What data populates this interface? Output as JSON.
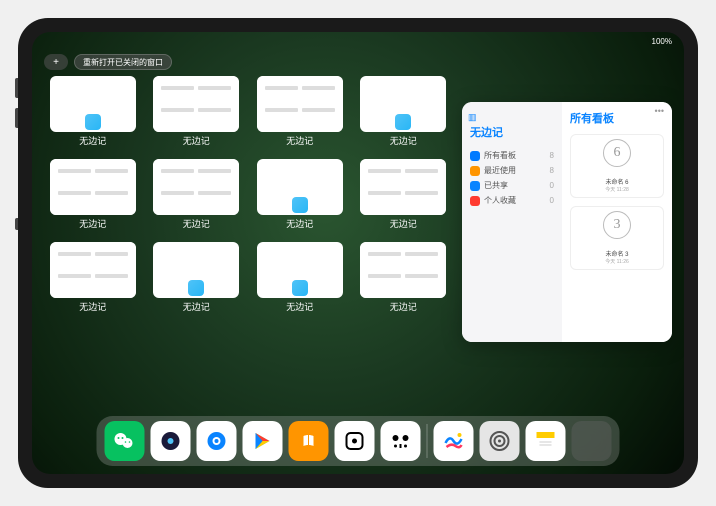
{
  "status": {
    "time": "",
    "battery": "100%"
  },
  "topbar": {
    "plus": "+",
    "reopen": "重新打开已关闭的窗口"
  },
  "switcher": {
    "app_name": "无边记",
    "cards": [
      {
        "type": "blank"
      },
      {
        "type": "split"
      },
      {
        "type": "split"
      },
      {
        "type": "blank"
      },
      {
        "type": "split"
      },
      {
        "type": "split"
      },
      {
        "type": "blank"
      },
      {
        "type": "split"
      },
      {
        "type": "split"
      },
      {
        "type": "blank"
      },
      {
        "type": "blank"
      },
      {
        "type": "split"
      }
    ]
  },
  "window": {
    "sidebar_title": "无边记",
    "right_title": "所有看板",
    "items": [
      {
        "label": "所有看板",
        "count": 8,
        "color": "#007aff"
      },
      {
        "label": "最近使用",
        "count": 8,
        "color": "#ff9500"
      },
      {
        "label": "已共享",
        "count": 0,
        "color": "#0a84ff"
      },
      {
        "label": "个人收藏",
        "count": 0,
        "color": "#ff3b30"
      }
    ],
    "boards": [
      {
        "sketch": "6",
        "name": "未命名 6",
        "time": "今天 11:28"
      },
      {
        "sketch": "3",
        "name": "未命名 3",
        "time": "今天 11:26"
      }
    ]
  },
  "dock": {
    "apps": [
      {
        "name": "wechat",
        "bg": "#07c160"
      },
      {
        "name": "browser-dark",
        "bg": "#ffffff"
      },
      {
        "name": "browser-blue",
        "bg": "#ffffff"
      },
      {
        "name": "play",
        "bg": "#ffffff"
      },
      {
        "name": "books",
        "bg": "#ff9500"
      },
      {
        "name": "dice",
        "bg": "#ffffff"
      },
      {
        "name": "camera-scan",
        "bg": "#ffffff"
      },
      {
        "name": "freeform",
        "bg": "#ffffff"
      },
      {
        "name": "settings",
        "bg": "#e5e5e5"
      },
      {
        "name": "notes",
        "bg": "#ffffff"
      }
    ]
  }
}
